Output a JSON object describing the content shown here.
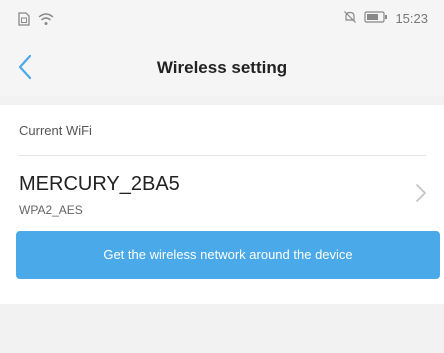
{
  "status_bar": {
    "time": "15:23",
    "icons": [
      "sim-icon",
      "wifi-icon",
      "mute-icon",
      "battery-icon"
    ]
  },
  "nav": {
    "title": "Wireless setting",
    "back_icon": "chevron-left-icon"
  },
  "current_wifi": {
    "section_label": "Current WiFi",
    "name": "MERCURY_2BA5",
    "security": "WPA2_AES"
  },
  "scan_button": {
    "label": "Get the wireless network around the device"
  },
  "colors": {
    "accent": "#4aa9e8",
    "background": "#f2f2f2"
  }
}
